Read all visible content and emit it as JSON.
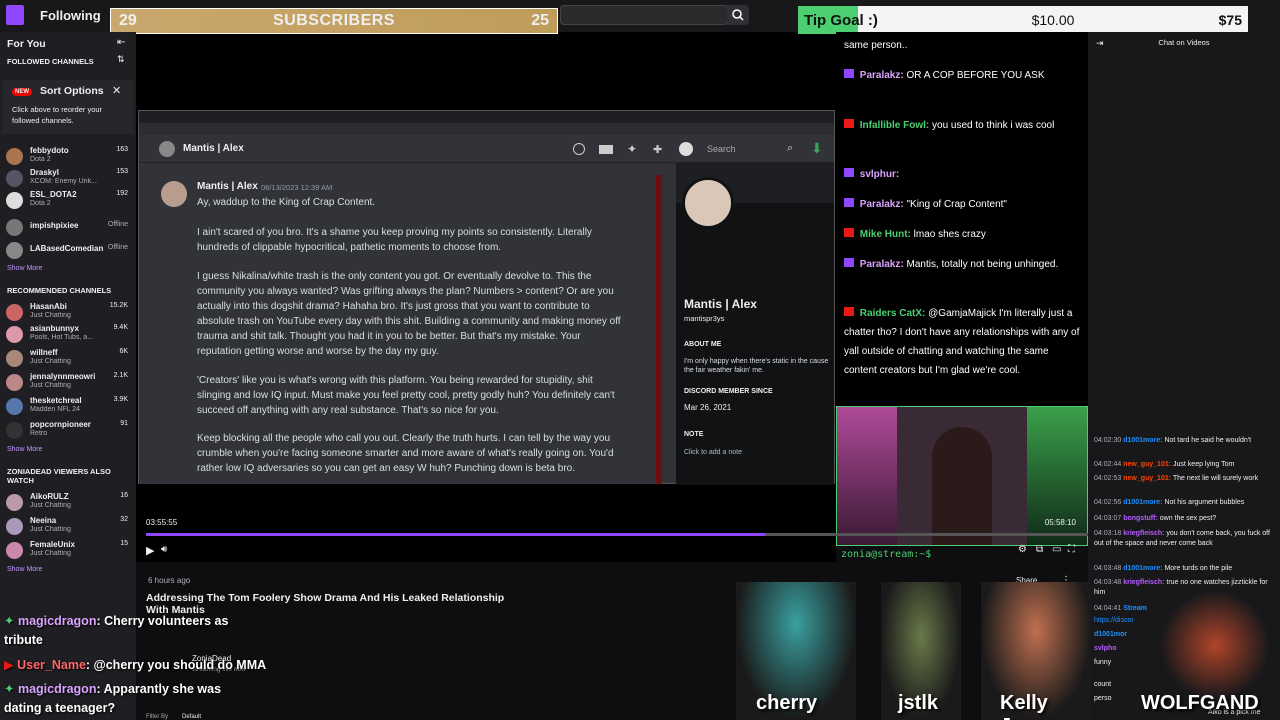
{
  "nav": {
    "following": "Following"
  },
  "sub_bar": {
    "left": "29",
    "label": "SUBSCRIBERS",
    "right": "25"
  },
  "tip_goal": {
    "label": "Tip Goal :)",
    "current": "$10.00",
    "target": "$75",
    "progress_fraction": 0.133
  },
  "sidebar": {
    "for_you": "For You",
    "followed_header": "FOLLOWED CHANNELS",
    "sort_title": "Sort Options",
    "sort_new": "NEW",
    "sort_desc": "Click above to reorder your followed channels.",
    "followed": [
      {
        "name": "febbydoto",
        "game": "Dota 2",
        "viewers": "163"
      },
      {
        "name": "Draskyl",
        "game": "XCOM: Enemy Unk...",
        "viewers": "153"
      },
      {
        "name": "ESL_DOTA2",
        "game": "Dota 2",
        "viewers": "192"
      },
      {
        "name": "impishpixiee",
        "game": "",
        "viewers": "Offline"
      },
      {
        "name": "LABasedComedian",
        "game": "",
        "viewers": "Offline"
      }
    ],
    "show_more": "Show More",
    "recommended_header": "RECOMMENDED CHANNELS",
    "recommended": [
      {
        "name": "HasanAbi",
        "game": "Just Chatting",
        "viewers": "15.2K"
      },
      {
        "name": "asianbunnyx",
        "game": "Pools, Hot Tubs, a...",
        "viewers": "9.4K"
      },
      {
        "name": "willneff",
        "game": "Just Chatting",
        "viewers": "6K"
      },
      {
        "name": "jennalynnmeowri",
        "game": "Just Chatting",
        "viewers": "2.1K"
      },
      {
        "name": "thesketchreal",
        "game": "Madden NFL 24",
        "viewers": "3.9K"
      },
      {
        "name": "popcornpioneer",
        "game": "Retro",
        "viewers": "91"
      }
    ],
    "also_watch_header": "ZONIADEAD VIEWERS ALSO WATCH",
    "also_watch": [
      {
        "name": "AikoRULZ",
        "game": "Just Chatting",
        "viewers": "16"
      },
      {
        "name": "Neeina",
        "game": "Just Chatting",
        "viewers": "32"
      },
      {
        "name": "FemaleUnix",
        "game": "Just Chatting",
        "viewers": "15"
      }
    ]
  },
  "discord": {
    "channel_name": "Mantis | Alex",
    "search_placeholder": "Search",
    "author": "Mantis | Alex",
    "date": "08/13/2023 12:39 AM",
    "paragraphs": [
      "Ay, waddup to the King of Crap Content.",
      "I ain't scared of you bro. It's a shame you keep proving my points so consistently. Literally hundreds of clippable hypocritical, pathetic moments to choose from.",
      "I guess Nikalina/white trash is the only content you got. Or eventually devolve to. This the community you always wanted? Was grifting always the plan? Numbers > content? Or are you actually into this dogshit drama? Hahaha bro. It's just gross that you want to contribute to absolute trash on YouTube every day with this shit. Building a community and making money off trauma and shit talk. Thought you had it in you to be better. But that's my mistake. Your reputation getting worse and worse by the day my guy.",
      "'Creators' like you is what's wrong with this platform. You being rewarded for stupidity, shit slinging and low IQ input. Must make you feel pretty cool, pretty godly huh? You definitely can't succeed off anything with any real substance. That's so nice for you.",
      "Keep blocking all the people who call you out. Clearly the truth hurts. I can tell by the way you crumble when you're facing someone smarter and more aware of what's really going on. You'd rather low IQ adversaries so you can get an easy W huh? Punching down is beta bro."
    ],
    "profile": {
      "name": "Mantis | Alex",
      "handle": "mantispr3ys",
      "about_header": "ABOUT ME",
      "about_text": "I'm only happy when there's static in the cause the fair weather fakin' me.",
      "member_header": "DISCORD MEMBER SINCE",
      "member_since": "Mar 26, 2021",
      "note_header": "NOTE",
      "note_placeholder": "Click to add a note"
    },
    "tab_label": "zonia"
  },
  "overlay_chat": [
    {
      "user": "",
      "text": "same person.."
    },
    {
      "user": "Paralakz:",
      "text": "OR A COP BEFORE YOU ASK"
    },
    {
      "user": "Infallible Fowl:",
      "text": "you used to think i was cool"
    },
    {
      "user": "svlphur:",
      "text": ""
    },
    {
      "user": "Paralakz:",
      "text": "\"King of Crap Content\""
    },
    {
      "user": "Mike Hunt:",
      "text": "lmao shes crazy"
    },
    {
      "user": "Paralakz:",
      "text": "Mantis, totally not being unhinged."
    },
    {
      "user": "Raiders CatX:",
      "text": "@GamjaMajick I'm literally just a chatter tho? I don't have any relationships with any of yall outside of chatting and watching the same content creators but I'm glad we're cool."
    }
  ],
  "webcam": {
    "terminal_text": "zonia@stream:~$"
  },
  "player": {
    "elapsed": "03:55:55",
    "duration": "05:58:10",
    "progress_fraction": 0.657
  },
  "stream_info": {
    "age": "6 hours ago",
    "title": "Addressing The Tom Foolery Show Drama And His Leaked Relationship With Mantis",
    "share": "Share",
    "streamer": "ZoniaDead",
    "live_now": "streaming live now",
    "filter_label": "Filter By",
    "filter_value": "Default"
  },
  "right_chat": {
    "header": "Chat on Videos",
    "lines": [
      {
        "ts": "04:02:30",
        "user": "d1001more:",
        "text": "Not tard he said he wouldn't"
      },
      {
        "ts": "04:02:44",
        "user": "new_guy_101:",
        "text": "Just keep lying Tom"
      },
      {
        "ts": "04:02:53",
        "user": "new_guy_101:",
        "text": "The next lie will surely work"
      },
      {
        "ts": "04:02:56",
        "user": "d1001more:",
        "text": "Not his argument bubbles"
      },
      {
        "ts": "04:03:07",
        "user": "bongstuff:",
        "text": "own the sex pest?"
      },
      {
        "ts": "04:03:18",
        "user": "kriegfleisch:",
        "text": "you don't come back, you fuck off out of the space and never come back"
      },
      {
        "ts": "04:03:48",
        "user": "d1001more:",
        "text": "More turds on the pile"
      },
      {
        "ts": "04:03:48",
        "user": "kriegfleisch:",
        "text": "true no one watches jizztickle for him"
      },
      {
        "ts": "04:04:41",
        "user": "Stream",
        "text": ""
      },
      {
        "ts": "",
        "user": "",
        "text": "https://discor"
      },
      {
        "ts": "",
        "user": "d1001mor",
        "text": ""
      },
      {
        "ts": "",
        "user": "svlpho",
        "text": ""
      },
      {
        "ts": "",
        "user": "",
        "text": "funny"
      },
      {
        "ts": "",
        "user": "",
        "text": "count"
      },
      {
        "ts": "",
        "user": "",
        "text": "perso"
      },
      {
        "ts": "",
        "user": "",
        "text": "Aiko is a pick me"
      }
    ]
  },
  "bottom_overlay_chat": [
    {
      "user": "magicdragon",
      "text": ": Cherry volunteers as tribute"
    },
    {
      "user": "User_Name",
      "text": ": @cherry you should do MMA"
    },
    {
      "user": "magicdragon",
      "text": ": Apparantly she was dating a teenager?"
    }
  ],
  "characters": [
    {
      "name": "cherry"
    },
    {
      "name": "jstlk"
    },
    {
      "name": "Kelly Jean"
    },
    {
      "name": "WOLFGAND"
    }
  ],
  "colors": {
    "twitch_purple": "#9147ff",
    "green": "#4ccf70",
    "subbar_gold": "#c8a86d"
  }
}
